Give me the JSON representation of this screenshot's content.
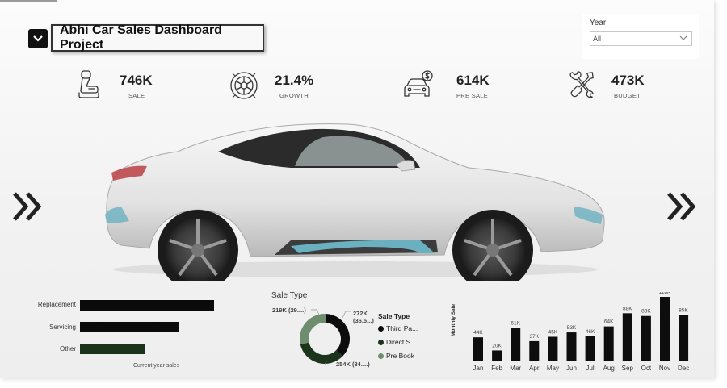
{
  "title": "Abhi Car Sales Dashboard Project",
  "slicer": {
    "label": "Year",
    "value": "All"
  },
  "kpis": {
    "sale": {
      "value": "746K",
      "label": "SALE",
      "icon": "car-seat-icon"
    },
    "growth": {
      "value": "21.4%",
      "label": "GROWTH",
      "icon": "tire-icon"
    },
    "pre_sale": {
      "value": "614K",
      "label": "PRE SALE",
      "icon": "car-dollar-icon"
    },
    "budget": {
      "value": "473K",
      "label": "BUDGET",
      "icon": "tools-icon"
    }
  },
  "colors": {
    "dark": "#111111",
    "green_dark": "#1b3a1b",
    "green_grey": "#6b8a6b"
  },
  "hbar": {
    "xlabel": "Current year sales",
    "categories": [
      "Replacement",
      "Servicing",
      "Other"
    ],
    "values": [
      1.0,
      0.74,
      0.49
    ],
    "colors": [
      "#0b0b0b",
      "#0b0b0b",
      "#1b321b"
    ]
  },
  "donut": {
    "title": "Sale Type",
    "legend_title": "Sale Type",
    "labels": {
      "third_party": "272K\n(36.5...)",
      "pre_book": "219K (29....)",
      "direct": "254K (34....)"
    },
    "legend": [
      "Third Pa...",
      "Direct S...",
      "Pre Book"
    ]
  },
  "chart_data": [
    {
      "type": "bar",
      "title": "",
      "categories": [
        "Replacement",
        "Servicing",
        "Other"
      ],
      "values": [
        1.0,
        0.74,
        0.49
      ],
      "xlabel": "Current year sales",
      "ylabel": ""
    },
    {
      "type": "pie",
      "title": "Sale Type",
      "categories": [
        "Third Pa...",
        "Direct S...",
        "Pre Book"
      ],
      "values": [
        272,
        254,
        219
      ],
      "colors": [
        "#0c0c0c",
        "#1c341c",
        "#6e8c6e"
      ]
    },
    {
      "type": "bar",
      "title": "",
      "ylabel": "Monthly Sale",
      "categories": [
        "Jan",
        "Feb",
        "Mar",
        "Apr",
        "May",
        "Jun",
        "Jul",
        "Aug",
        "Sep",
        "Oct",
        "Nov",
        "Dec"
      ],
      "values": [
        44,
        20,
        61,
        37,
        45,
        53,
        46,
        64,
        88,
        83,
        118,
        85
      ],
      "data_labels": [
        "44K",
        "20K",
        "61K",
        "37K",
        "45K",
        "53K",
        "46K",
        "64K",
        "88K",
        "83K",
        "118K",
        "85K"
      ],
      "ylim": [
        0,
        118
      ]
    }
  ]
}
